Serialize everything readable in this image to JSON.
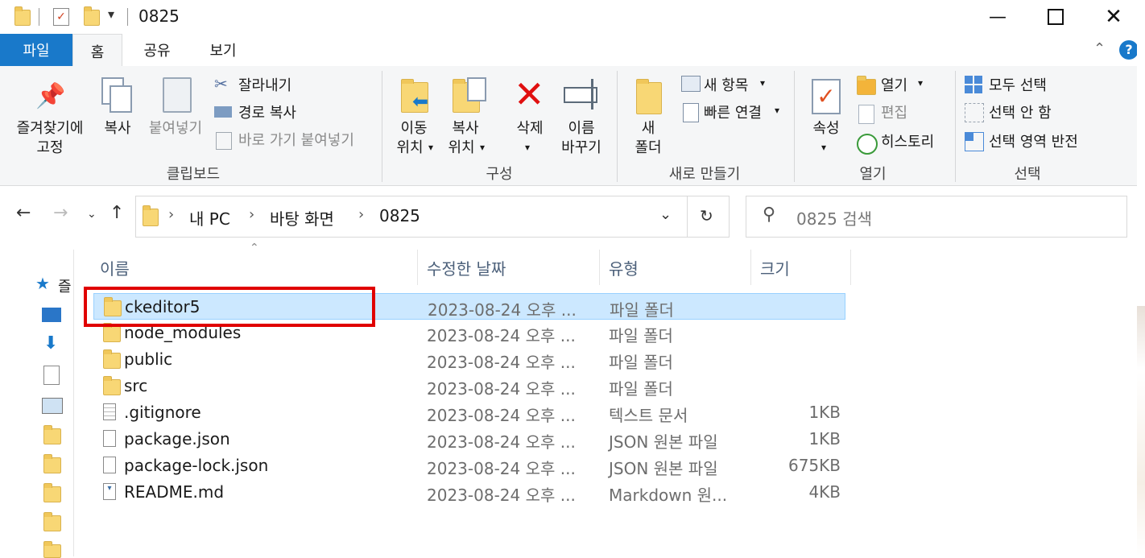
{
  "window": {
    "title": "0825"
  },
  "tabs": {
    "file": "파일",
    "home": "홈",
    "share": "공유",
    "view": "보기"
  },
  "ribbon": {
    "clipboard": {
      "pin_label_1": "즐겨찾기에",
      "pin_label_2": "고정",
      "copy": "복사",
      "paste": "붙여넣기",
      "cut": "잘라내기",
      "copy_path": "경로 복사",
      "paste_shortcut": "바로 가기 붙여넣기",
      "group": "클립보드"
    },
    "organize": {
      "move_1": "이동",
      "move_2": "위치",
      "copyto_1": "복사",
      "copyto_2": "위치",
      "delete": "삭제",
      "rename_1": "이름",
      "rename_2": "바꾸기",
      "group": "구성"
    },
    "new": {
      "new_folder_1": "새",
      "new_folder_2": "폴더",
      "new_item": "새 항목",
      "easy_access": "빠른 연결",
      "group": "새로 만들기"
    },
    "open": {
      "properties": "속성",
      "open": "열기",
      "edit": "편집",
      "history": "히스토리",
      "group": "열기"
    },
    "select": {
      "select_all": "모두 선택",
      "select_none": "선택 안 함",
      "invert": "선택 영역 반전",
      "group": "선택"
    }
  },
  "address": {
    "crumbs": [
      "내 PC",
      "바탕 화면",
      "0825"
    ],
    "search_placeholder": "0825 검색"
  },
  "left_pane_label": "즐",
  "columns": {
    "name": "이름",
    "date": "수정한 날짜",
    "type": "유형",
    "size": "크기"
  },
  "files": [
    {
      "name": "ckeditor5",
      "date": "2023-08-24 오후 ...",
      "type": "파일 폴더",
      "size": "",
      "kind": "folder"
    },
    {
      "name": "node_modules",
      "date": "2023-08-24 오후 ...",
      "type": "파일 폴더",
      "size": "",
      "kind": "folder"
    },
    {
      "name": "public",
      "date": "2023-08-24 오후 ...",
      "type": "파일 폴더",
      "size": "",
      "kind": "folder"
    },
    {
      "name": "src",
      "date": "2023-08-24 오후 ...",
      "type": "파일 폴더",
      "size": "",
      "kind": "folder"
    },
    {
      "name": ".gitignore",
      "date": "2023-08-24 오후 ...",
      "type": "텍스트 문서",
      "size": "1KB",
      "kind": "text"
    },
    {
      "name": "package.json",
      "date": "2023-08-24 오후 ...",
      "type": "JSON 원본 파일",
      "size": "1KB",
      "kind": "json"
    },
    {
      "name": "package-lock.json",
      "date": "2023-08-24 오후 ...",
      "type": "JSON 원본 파일",
      "size": "675KB",
      "kind": "json"
    },
    {
      "name": "README.md",
      "date": "2023-08-24 오후 ...",
      "type": "Markdown 원...",
      "size": "4KB",
      "kind": "md"
    }
  ],
  "colors": {
    "accent": "#1979ca",
    "selection": "#cce8ff",
    "highlight_box": "#e00000"
  }
}
